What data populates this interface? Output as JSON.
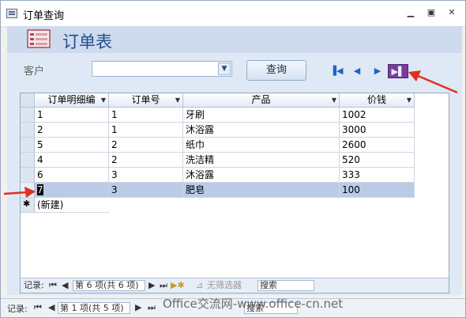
{
  "window": {
    "title": "订单查询"
  },
  "form": {
    "title": "订单表",
    "customer_label": "客户",
    "customer_value": "",
    "query_button": "查询"
  },
  "nav_buttons": [
    "first-record",
    "previous-record",
    "next-record",
    "last-record"
  ],
  "table": {
    "columns": [
      "订单明细编",
      "订单号",
      "产品",
      "价钱"
    ],
    "rows": [
      {
        "id": "1",
        "order": "1",
        "product": "牙刷",
        "price": "1002"
      },
      {
        "id": "2",
        "order": "1",
        "product": "沐浴露",
        "price": "3000"
      },
      {
        "id": "5",
        "order": "2",
        "product": "纸巾",
        "price": "2600"
      },
      {
        "id": "4",
        "order": "2",
        "product": "洗洁精",
        "price": "520"
      },
      {
        "id": "6",
        "order": "3",
        "product": "沐浴露",
        "price": "333"
      },
      {
        "id": "7",
        "order": "3",
        "product": "肥皂",
        "price": "100"
      }
    ],
    "selected_row_index": 5,
    "new_row_marker": "✱",
    "new_row_label": "(新建)"
  },
  "inner_record_bar": {
    "label": "记录:",
    "position": "第 6 项(共 6 项)",
    "filter": "无筛选器",
    "search": "搜索"
  },
  "outer_record_bar": {
    "label": "记录:",
    "position": "第 1 项(共 5 项)",
    "search": "搜索"
  },
  "watermark": "Office交流网-www.office-cn.net",
  "colors": {
    "title": "#1f4f8f",
    "selected_row": "#b9cbe6",
    "annotation_arrow": "#e03020",
    "last_button": "#7d3a9c"
  }
}
